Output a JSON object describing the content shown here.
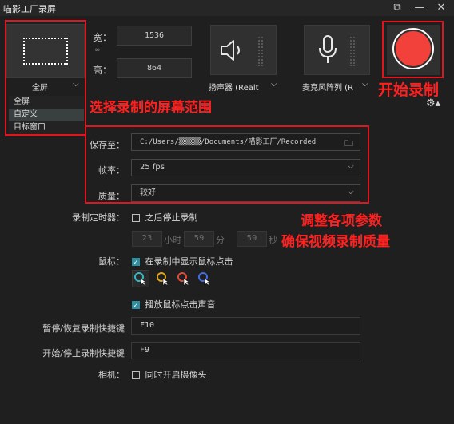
{
  "window": {
    "title": "喵影工厂录屏"
  },
  "capture": {
    "mode_selected": "全屏",
    "mode_options": [
      "全屏",
      "自定义",
      "目标窗口"
    ],
    "width_label": "宽：",
    "width_value": "1536",
    "height_label": "高：",
    "height_value": "864"
  },
  "audio": {
    "speaker_label": "扬声器 (Realt",
    "mic_label": "麦克风阵列 (R"
  },
  "record": {
    "start_annotation": "开始录制"
  },
  "annotations": {
    "select_area": "选择录制的屏幕范围",
    "adjust_line1": "调整各项参数",
    "adjust_line2": "确保视频录制质量"
  },
  "settings": {
    "save_label": "保存至：",
    "save_path": "C:/Users/▒▒▒▒▒/Documents/喵影工厂/Recorded",
    "fps_label": "帧率：",
    "fps_value": "25 fps",
    "quality_label": "质量：",
    "quality_value": "较好",
    "timer_label": "录制定时器：",
    "timer_check_label": "之后停止录制",
    "timer_hours": "23",
    "timer_hours_unit": "小时",
    "timer_minutes": "59",
    "timer_minutes_unit": "分",
    "timer_seconds": "59",
    "timer_seconds_unit": "秒",
    "mouse_label": "鼠标：",
    "mouse_show_clicks_label": "在录制中显示鼠标点击",
    "mouse_sound_label": "播放鼠标点击声音",
    "pause_hotkey_label": "暂停/恢复录制快捷键",
    "pause_hotkey_value": "F10",
    "start_hotkey_label": "开始/停止录制快捷键",
    "start_hotkey_value": "F9",
    "camera_label": "相机：",
    "camera_check_label": "同时开启摄像头"
  },
  "colors": {
    "annotation_red": "#e3141e",
    "record_button": "#f2413a",
    "checkbox_teal": "#2d8fa0",
    "cursor_colors": [
      "#39b6c9",
      "#e0a31a",
      "#e04a3a",
      "#3f6fe0"
    ]
  },
  "icons": {
    "speaker": "speaker-icon",
    "microphone": "microphone-icon",
    "settings": "gear-icon",
    "folder": "folder-icon",
    "link": "link-icon"
  }
}
